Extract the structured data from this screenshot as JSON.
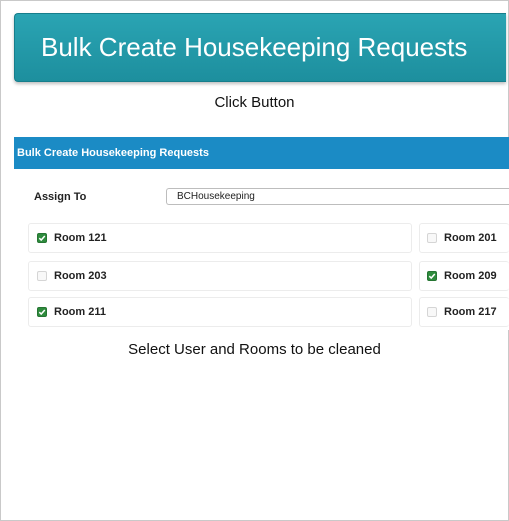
{
  "button": {
    "label": "Bulk Create Housekeeping Requests"
  },
  "captions": {
    "click_button": "Click Button",
    "select_rooms": "Select User and Rooms to be cleaned"
  },
  "panel": {
    "title": "Bulk Create Housekeeping Requests",
    "assign_label": "Assign To",
    "assign_value": "BCHousekeeping",
    "rooms": [
      {
        "label": "Room 121",
        "checked": true
      },
      {
        "label": "Room 201",
        "checked": false
      },
      {
        "label": "Room 203",
        "checked": false
      },
      {
        "label": "Room 209",
        "checked": true
      },
      {
        "label": "Room 211",
        "checked": true
      },
      {
        "label": "Room 217",
        "checked": false
      }
    ]
  },
  "colors": {
    "button": "#1d8f9e",
    "panel_header": "#1b8bc5",
    "checkbox_checked": "#2e8b3d"
  }
}
